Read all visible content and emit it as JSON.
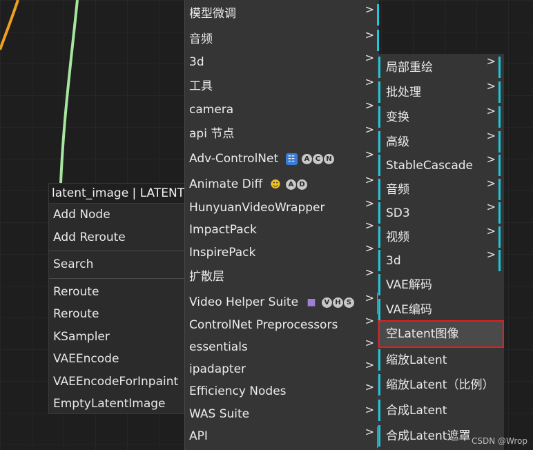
{
  "context_menu": {
    "title": "latent_image | LATENT",
    "items": [
      "Add Node",
      "Add Reroute",
      "Search",
      "Reroute",
      "Reroute",
      "KSampler",
      "VAEEncode",
      "VAEEncodeForInpaint",
      "EmptyLatentImage"
    ]
  },
  "category_menu": {
    "items": [
      {
        "label": "模型微调"
      },
      {
        "label": "音频"
      },
      {
        "label": "3d"
      },
      {
        "label": "工具"
      },
      {
        "label": "camera"
      },
      {
        "label": "api 节点"
      },
      {
        "label": "Adv-ControlNet",
        "badges": [
          "A",
          "C",
          "N"
        ]
      },
      {
        "label": "Animate Diff",
        "badges": [
          "A",
          "D"
        ]
      },
      {
        "label": "HunyuanVideoWrapper"
      },
      {
        "label": "ImpactPack"
      },
      {
        "label": "InspirePack"
      },
      {
        "label": "扩散层"
      },
      {
        "label": "Video Helper Suite",
        "badges": [
          "V",
          "H",
          "S"
        ]
      },
      {
        "label": "ControlNet Preprocessors"
      },
      {
        "label": "essentials"
      },
      {
        "label": "ipadapter"
      },
      {
        "label": "Efficiency Nodes"
      },
      {
        "label": "WAS Suite"
      },
      {
        "label": "API"
      }
    ],
    "arrow": ">"
  },
  "latent_menu": {
    "items": [
      {
        "label": "局部重绘",
        "submenu": true
      },
      {
        "label": "批处理",
        "submenu": true
      },
      {
        "label": "变换",
        "submenu": true
      },
      {
        "label": "高级",
        "submenu": true
      },
      {
        "label": "StableCascade",
        "submenu": true
      },
      {
        "label": "音频",
        "submenu": true
      },
      {
        "label": "SD3",
        "submenu": true
      },
      {
        "label": "视频",
        "submenu": true
      },
      {
        "label": "3d",
        "submenu": true
      },
      {
        "label": "VAE解码",
        "submenu": false
      },
      {
        "label": "VAE编码",
        "submenu": false
      },
      {
        "label": "空Latent图像",
        "submenu": false,
        "selected": true
      },
      {
        "label": "缩放Latent",
        "submenu": false
      },
      {
        "label": "缩放Latent（比例）",
        "submenu": false
      },
      {
        "label": "合成Latent",
        "submenu": false
      },
      {
        "label": "合成Latent遮罩",
        "submenu": false
      }
    ]
  },
  "watermark": "CSDN @Wrop",
  "colors": {
    "accent": "#1ec8dc",
    "highlight_border": "#e02020",
    "wire_green": "#a6e6a0",
    "wire_orange": "#f0a020"
  }
}
